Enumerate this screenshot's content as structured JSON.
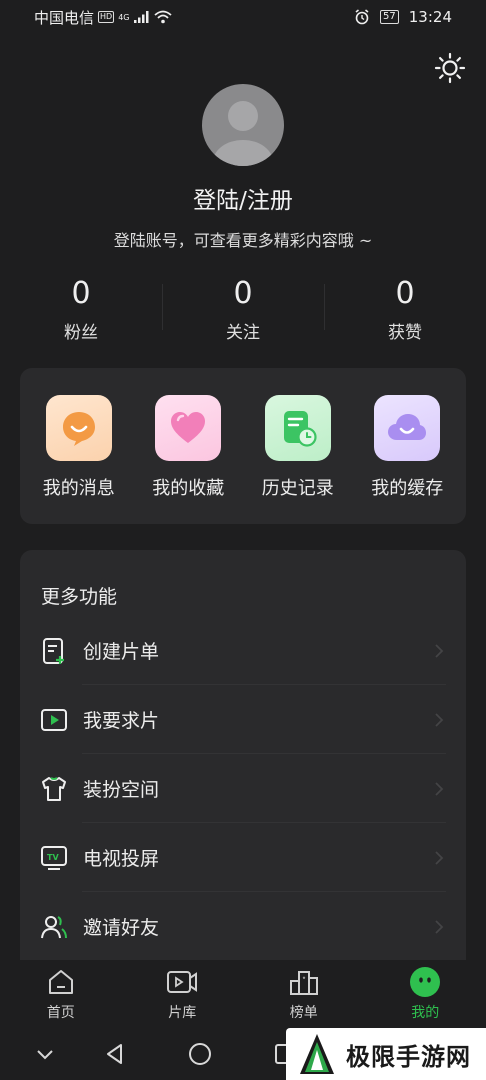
{
  "status_bar": {
    "carrier": "中国电信",
    "hd": "HD",
    "network": "4G",
    "battery": "57",
    "time": "13:24"
  },
  "profile": {
    "login_title": "登陆/注册",
    "login_subtitle": "登陆账号，可查看更多精彩内容哦 ~"
  },
  "stats": [
    {
      "value": "0",
      "label": "粉丝"
    },
    {
      "value": "0",
      "label": "关注"
    },
    {
      "value": "0",
      "label": "获赞"
    }
  ],
  "quick_actions": [
    {
      "label": "我的消息",
      "icon": "message-icon",
      "color": "#f2a04a"
    },
    {
      "label": "我的收藏",
      "icon": "heart-icon",
      "color": "#f07ab3"
    },
    {
      "label": "历史记录",
      "icon": "history-icon",
      "color": "#44c66a"
    },
    {
      "label": "我的缓存",
      "icon": "cloud-icon",
      "color": "#a98ef0"
    }
  ],
  "more": {
    "title": "更多功能",
    "items": [
      {
        "label": "创建片单",
        "icon": "create-list-icon"
      },
      {
        "label": "我要求片",
        "icon": "request-video-icon"
      },
      {
        "label": "装扮空间",
        "icon": "tshirt-icon"
      },
      {
        "label": "电视投屏",
        "icon": "tv-cast-icon"
      },
      {
        "label": "邀请好友",
        "icon": "invite-friends-icon"
      }
    ]
  },
  "tabs": [
    {
      "label": "首页",
      "icon": "home-icon",
      "active": false
    },
    {
      "label": "片库",
      "icon": "library-icon",
      "active": false
    },
    {
      "label": "榜单",
      "icon": "ranking-icon",
      "active": false
    },
    {
      "label": "我的",
      "icon": "mine-icon",
      "active": true
    }
  ],
  "watermark": {
    "text": "极限手游网"
  },
  "colors": {
    "accent": "#2fc04f",
    "background": "#1e1e1f",
    "card": "#2a2a2c"
  }
}
